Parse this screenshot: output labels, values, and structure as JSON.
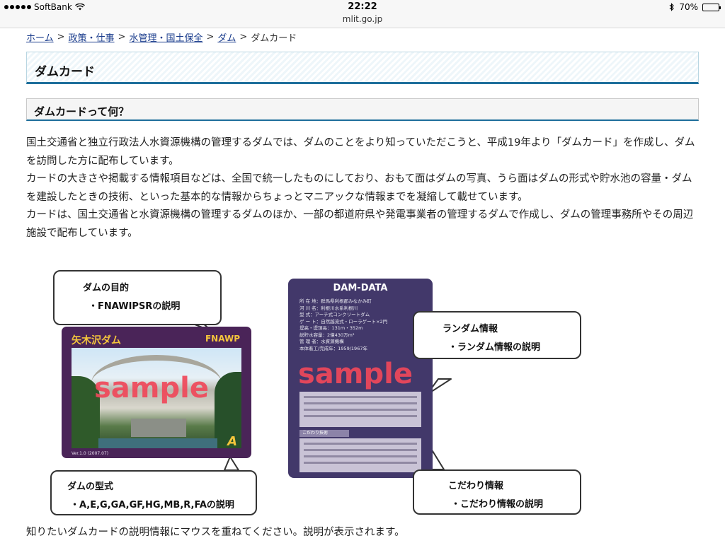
{
  "status_bar": {
    "carrier": "SoftBank",
    "time": "22:22",
    "url": "mlit.go.jp",
    "battery": "70%",
    "battery_level": 0.7
  },
  "breadcrumb": [
    {
      "label": "ホーム",
      "link": true
    },
    {
      "label": "政策・仕事",
      "link": true
    },
    {
      "label": "水管理・国土保全",
      "link": true
    },
    {
      "label": "ダム",
      "link": true
    },
    {
      "label": "ダムカード",
      "link": false
    }
  ],
  "breadcrumb_sep": ">",
  "page_title": "ダムカード",
  "section_title": "ダムカードって何？",
  "paragraphs": [
    "国土交通省と独立行政法人水資源機構の管理するダムでは、ダムのことをより知っていただこうと、平成19年より「ダムカード」を作成し、ダムを訪問した方に配布しています。",
    "カードの大きさや掲載する情報項目などは、全国で統一したものにしており、おもて面はダムの写真、うら面はダムの形式や貯水池の容量・ダムを建設したときの技術、といった基本的な情報からちょっとマニアックな情報までを凝縮して載せています。",
    "カードは、国土交通省と水資源機構の管理するダムのほか、一部の都道府県や発電事業者の管理するダムで作成し、ダムの管理事務所やその周辺施設で配布しています。"
  ],
  "callouts": {
    "purpose": {
      "title": "ダムの目的",
      "desc": "・FNAWIPSRの説明"
    },
    "random": {
      "title": "ランダム情報",
      "desc": "・ランダム情報の説明"
    },
    "type": {
      "title": "ダムの型式",
      "desc": "・A,E,G,GA,GF,HG,MB,R,FAの説明"
    },
    "kodawari": {
      "title": "こだわり情報",
      "desc": "・こだわり情報の説明"
    }
  },
  "card_front": {
    "dam_name": "矢木沢ダム",
    "purpose_code": "FNAWP",
    "watermark": "sample",
    "type_letter": "A",
    "version": "Ver.1.0 (2007.07)"
  },
  "card_back": {
    "title": "DAM-DATA",
    "rows": [
      "所 在 地：群馬県利根郡みなかみ町",
      "河 川 名：利根川水系利根川",
      "型 式：アーチ式コンクリートダム",
      "ゲ ー ト：自然越流式・ローラゲート×2門",
      "堤高・堤頂長：131m・352m",
      "総貯水容量：2億430万m³",
      "管 理 者：水資源機構",
      "本体着工/完成年：1959/1967年"
    ],
    "watermark": "sample",
    "kodawari_label": "こだわり技術"
  },
  "footer": "知りたいダムカードの説明情報にマウスを重ねてください。説明が表示されます。",
  "colors": {
    "link": "#1a3c8c",
    "heading_border": "#1d6e9b",
    "card_front_bg": "#4a2458",
    "card_back_bg": "#42386a",
    "sample_watermark": "#f0485a",
    "card_text_accent": "#f4c53c"
  }
}
